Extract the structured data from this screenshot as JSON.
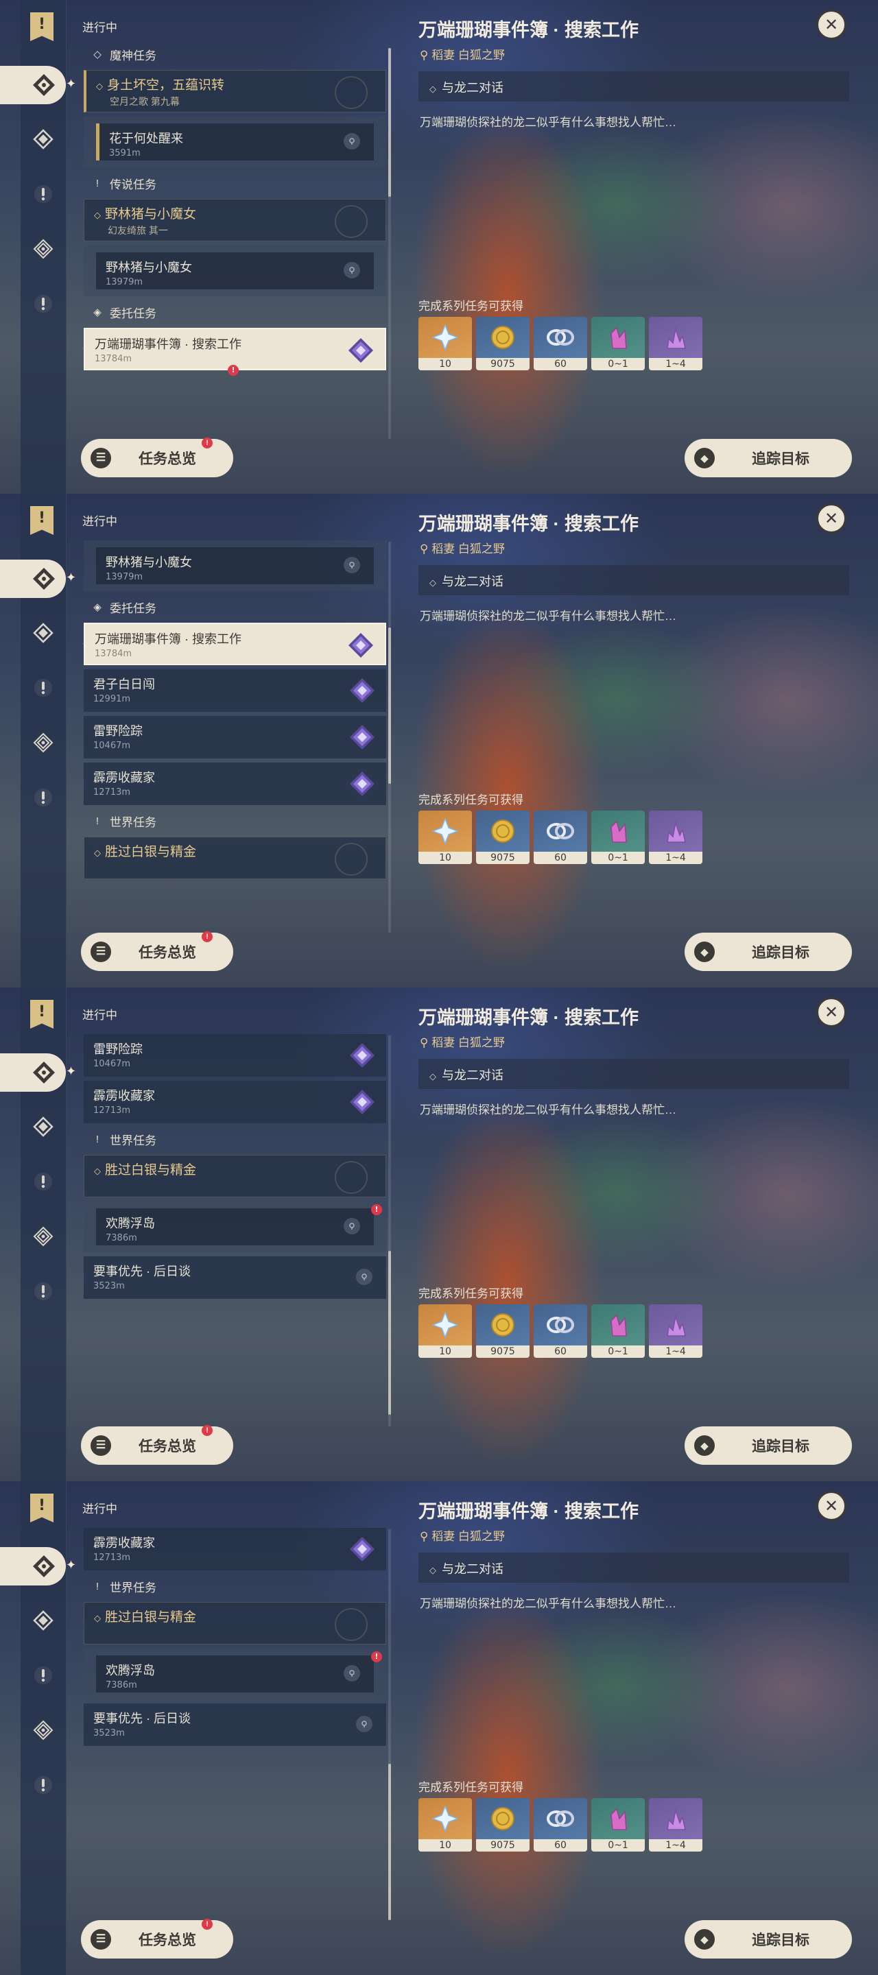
{
  "screens": [
    {
      "header": {
        "in_progress": "进行中"
      },
      "list": [
        {
          "type": "category",
          "icon": "archon-icon",
          "label": "魔神任务"
        },
        {
          "type": "main",
          "title": "身土坏空，五蕴识转",
          "subtitle": "空月之歌 第九幕",
          "accent": true
        },
        {
          "type": "sub",
          "title": "花于何处醒来",
          "distance": "3591m",
          "accent": true
        },
        {
          "type": "category",
          "icon": "exclaim-icon",
          "label": "传说任务"
        },
        {
          "type": "main",
          "title": "野林猪与小魔女",
          "subtitle": "幻友绮旅 其一",
          "accent": false
        },
        {
          "type": "sub",
          "title": "野林猪与小魔女",
          "distance": "13979m",
          "accent": false
        },
        {
          "type": "category",
          "icon": "commission-icon",
          "label": "委托任务"
        },
        {
          "type": "commission",
          "title": "万端珊瑚事件簿 · 搜索工作",
          "distance": "13784m",
          "selected": true,
          "badge": true
        }
      ],
      "scroll": {
        "thumb": 0.0,
        "size": 0.38
      }
    },
    {
      "header": {
        "in_progress": "进行中"
      },
      "list": [
        {
          "type": "sub",
          "title": "野林猪与小魔女",
          "distance": "13979m",
          "accent": false
        },
        {
          "type": "category",
          "icon": "commission-icon",
          "label": "委托任务"
        },
        {
          "type": "commission",
          "title": "万端珊瑚事件簿 · 搜索工作",
          "distance": "13784m",
          "selected": true,
          "badge": false
        },
        {
          "type": "commission",
          "title": "君子白日闯",
          "distance": "12991m",
          "selected": false
        },
        {
          "type": "commission",
          "title": "雷野险踪",
          "distance": "10467m",
          "selected": false
        },
        {
          "type": "commission",
          "title": "霹雳收藏家",
          "distance": "12713m",
          "selected": false
        },
        {
          "type": "category",
          "icon": "exclaim-icon",
          "label": "世界任务"
        },
        {
          "type": "main",
          "title": "胜过白银与精金",
          "subtitle": "",
          "accent": false
        }
      ],
      "scroll": {
        "thumb": 0.22,
        "size": 0.4
      }
    },
    {
      "header": {
        "in_progress": "进行中"
      },
      "list": [
        {
          "type": "commission",
          "title": "雷野险踪",
          "distance": "10467m",
          "selected": false
        },
        {
          "type": "commission",
          "title": "霹雳收藏家",
          "distance": "12713m",
          "selected": false
        },
        {
          "type": "category",
          "icon": "exclaim-icon",
          "label": "世界任务"
        },
        {
          "type": "main",
          "title": "胜过白银与精金",
          "subtitle": "",
          "accent": false
        },
        {
          "type": "sub",
          "title": "欢腾浮岛",
          "distance": "7386m",
          "accent": false,
          "badge": true
        },
        {
          "type": "plain",
          "title": "要事优先 · 后日谈",
          "distance": "3523m"
        }
      ],
      "scroll": {
        "thumb": 0.55,
        "size": 0.42
      }
    },
    {
      "header": {
        "in_progress": "进行中"
      },
      "list": [
        {
          "type": "commission",
          "title": "霹雳收藏家",
          "distance": "12713m",
          "selected": false
        },
        {
          "type": "category",
          "icon": "exclaim-icon",
          "label": "世界任务"
        },
        {
          "type": "main",
          "title": "胜过白银与精金",
          "subtitle": "",
          "accent": false
        },
        {
          "type": "sub",
          "title": "欢腾浮岛",
          "distance": "7386m",
          "accent": false,
          "badge": true
        },
        {
          "type": "plain",
          "title": "要事优先 · 后日谈",
          "distance": "3523m"
        }
      ],
      "scroll": {
        "thumb": 0.6,
        "size": 0.4
      }
    }
  ],
  "detail": {
    "title": "万端珊瑚事件簿 · 搜索工作",
    "location": "稻妻 白狐之野",
    "step": "与龙二对话",
    "description": "万端珊瑚侦探社的龙二似乎有什么事想找人帮忙…",
    "rewards_label": "完成系列任务可获得",
    "rewards": [
      {
        "name": "adventure-exp",
        "count": "10",
        "bg": "gold"
      },
      {
        "name": "mora",
        "count": "9075",
        "bg": "blue"
      },
      {
        "name": "companionship-exp",
        "count": "60",
        "bg": "blue"
      },
      {
        "name": "crystal-chunk",
        "count": "0~1",
        "bg": "green"
      },
      {
        "name": "crystal-shard",
        "count": "1~4",
        "bg": "purple"
      }
    ]
  },
  "buttons": {
    "overview": "任务总览",
    "track": "追踪目标"
  },
  "colors": {
    "accent": "#c9a860",
    "cream": "#ece5d6",
    "badge": "#e03a4a",
    "title_gold": "#e6c98d"
  }
}
